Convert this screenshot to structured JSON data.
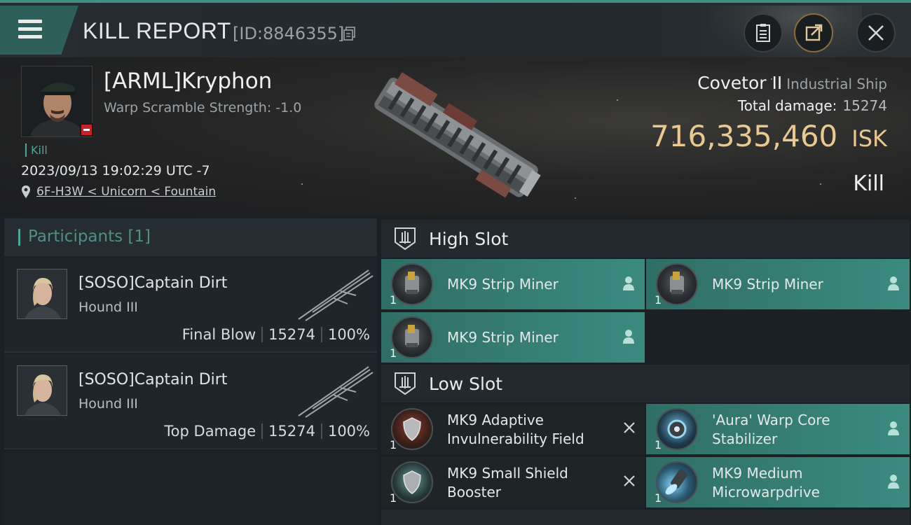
{
  "header": {
    "title": "KILL REPORT",
    "kill_id": "[ID:8846355]",
    "icons": [
      "menu-icon",
      "copy-icon",
      "clipboard-icon",
      "share-icon",
      "close-icon"
    ]
  },
  "victim": {
    "name": "[ARML]Kryphon",
    "warp_scramble": "Warp Scramble Strength: -1.0",
    "kill_tag": "Kill",
    "datetime": "2023/09/13 19:02:29 UTC -7",
    "location": "6F-H3W < Unicorn < Fountain"
  },
  "ship": {
    "name": "Covetor II",
    "class": "Industrial Ship",
    "damage_label": "Total damage:",
    "damage_value": "15274",
    "isk_value": "716,335,460",
    "isk_unit": "ISK",
    "result": "Kill"
  },
  "participants": {
    "title": "Participants [1]",
    "items": [
      {
        "name": "[SOSO]Captain Dirt",
        "ship": "Hound III",
        "role": "Final Blow",
        "damage": "15274",
        "percent": "100%"
      },
      {
        "name": "[SOSO]Captain Dirt",
        "ship": "Hound III",
        "role": "Top Damage",
        "damage": "15274",
        "percent": "100%"
      }
    ]
  },
  "slots": {
    "high": {
      "title": "High Slot",
      "modules": [
        {
          "name": "MK9 Strip Miner",
          "qty": "1"
        },
        {
          "name": "MK9 Strip Miner",
          "qty": "1"
        },
        {
          "name": "MK9 Strip Miner",
          "qty": "1"
        }
      ]
    },
    "low": {
      "title": "Low Slot",
      "modules": [
        {
          "name1": "MK9 Adaptive",
          "name2": "Invulnerability Field",
          "qty": "1"
        },
        {
          "name1": "'Aura' Warp Core",
          "name2": "Stabilizer",
          "qty": "1"
        },
        {
          "name1": "MK9 Small Shield",
          "name2": "Booster",
          "qty": "1"
        },
        {
          "name1": "MK9 Medium",
          "name2": "Microwarpdrive",
          "qty": "1"
        }
      ]
    }
  },
  "colors": {
    "accent_teal": "#3b8b80",
    "isk_gold": "#e9c98f",
    "status_red": "#c2242a"
  }
}
